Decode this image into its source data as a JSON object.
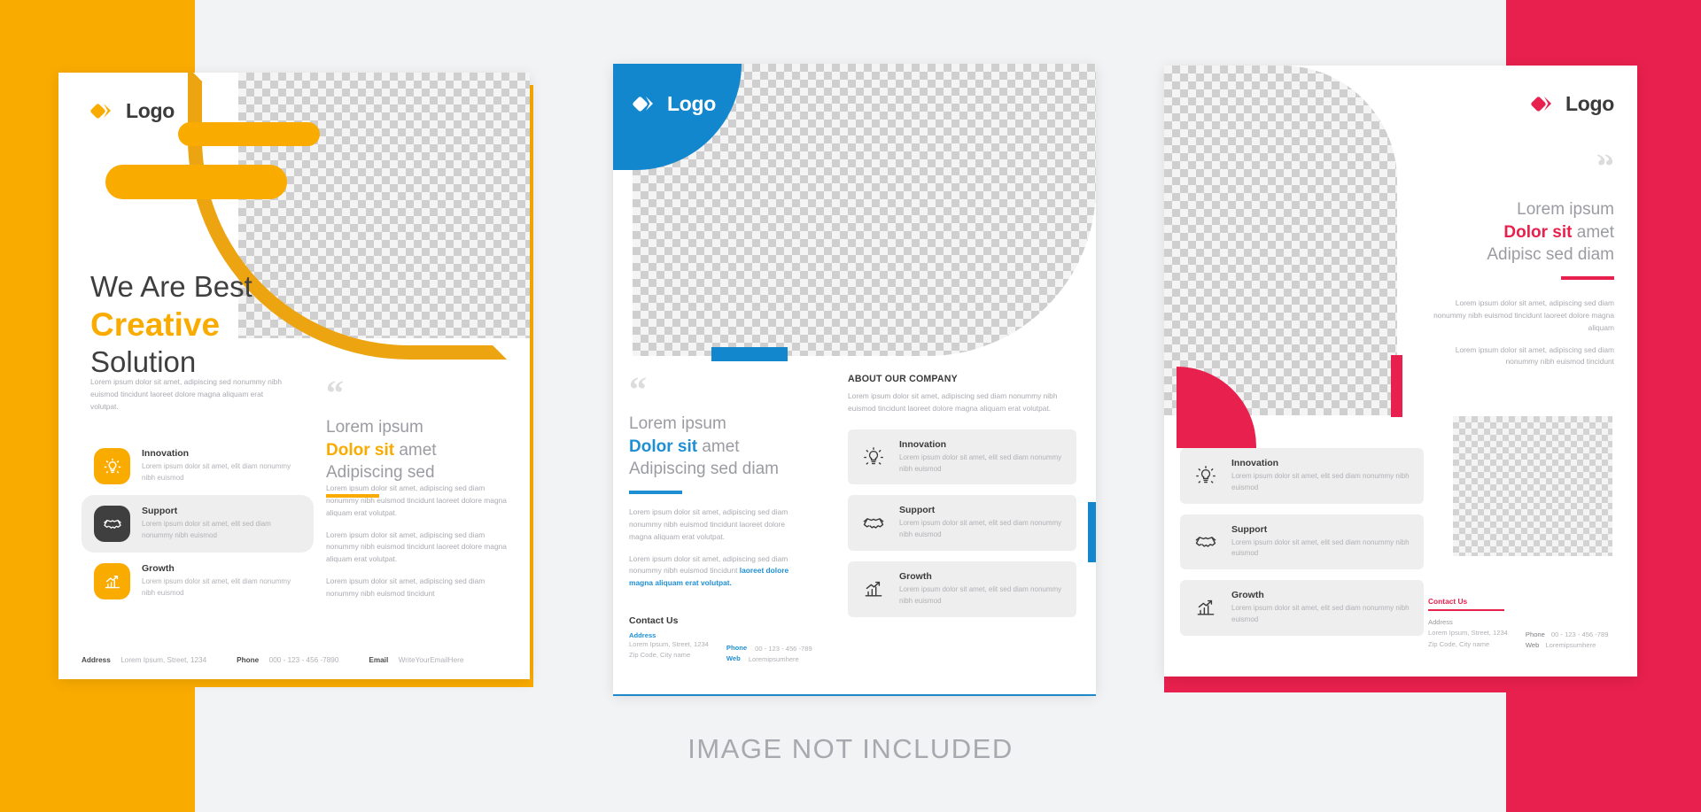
{
  "caption": "IMAGE NOT INCLUDED",
  "colors": {
    "yellow": "#FAAB00",
    "yellow_dark": "#ECA411",
    "blue": "#1287CE",
    "blue_accent": "#1F8FD4",
    "red": "#E8204D",
    "dark": "#3f3f3f",
    "muted": "#b0b1b6",
    "card_bg": "#eeeeee"
  },
  "common": {
    "logo_text": "Logo",
    "quote_glyph": "“",
    "lorem_3line": "Lorem ipsum dolor sit amet, adipiscing sed nonummy nibh euismod tincidunt laoreet dolore magna aliquam erat volutpat.",
    "features": [
      {
        "title": "Innovation",
        "body": "Lorem ipsum dolor sit amet, elit sed diam nonummy nibh euismod",
        "icon": "lightbulb-icon"
      },
      {
        "title": "Support",
        "body": "Lorem ipsum dolor sit amet, elit sed diam nonummy nibh euismod",
        "icon": "handshake-icon"
      },
      {
        "title": "Growth",
        "body": "Lorem ipsum dolor sit amet, elit sed diam nonummy nibh euismod",
        "icon": "bar-chart-growth-icon"
      }
    ]
  },
  "flyer1": {
    "logo_text": "Logo",
    "heading_line1": "We Are Best",
    "heading_line2": "Creative",
    "heading_line3": "Solution",
    "lead": "Lorem ipsum dolor sit amet, adipiscing sed nonummy nibh euismod tincidunt laoreet dolore magna aliquam erat volutpat.",
    "features": [
      {
        "title": "Innovation",
        "body": "Lorem ipsum dolor sit amet, elit diam nonummy nibh euismod",
        "icon": "lightbulb-icon",
        "style": "yellow"
      },
      {
        "title": "Support",
        "body": "Lorem ipsum dolor sit amet, elit sed diam nonummy nibh euismod",
        "icon": "handshake-icon",
        "style": "dark"
      },
      {
        "title": "Growth",
        "body": "Lorem ipsum dolor sit amet, elit diam nonummy nibh euismod",
        "icon": "bar-chart-growth-icon",
        "style": "yellow"
      }
    ],
    "quote": {
      "line1": "Lorem ipsum",
      "line2_bold": "Dolor sit",
      "line2_rest": " amet",
      "line3": "Adipiscing sed"
    },
    "quote_body": [
      "Lorem ipsum dolor sit amet, adipiscing sed diam nonummy nibh euismod tincidunt laoreet dolore magna aliquam erat volutpat.",
      "Lorem ipsum dolor sit amet, adipiscing sed diam nonummy nibh euismod tincidunt laoreet dolore magna aliquam erat volutpat.",
      "Lorem ipsum dolor sit amet, adipiscing sed diam nonummy nibh euismod tincidunt"
    ],
    "footer": {
      "address_label": "Address",
      "address_value": "Lorem Ipsum, Street, 1234",
      "phone_label": "Phone",
      "phone_value": "000 - 123 - 456 -7890",
      "email_label": "Email",
      "email_value": "WriteYourEmailHere"
    }
  },
  "flyer2": {
    "logo_text": "Logo",
    "quote": {
      "line1": "Lorem ipsum",
      "line2_bold": "Dolor sit",
      "line2_rest": " amet",
      "line3": "Adipiscing sed diam"
    },
    "body_p1": "Lorem ipsum dolor sit amet, adipiscing sed diam nonummy nibh euismod tincidunt laoreet dolore magna aliquam erat volutpat.",
    "body_p2_plain": "Lorem ipsum dolor sit amet, adipiscing sed diam nonummy nibh euismod tincidunt ",
    "body_p2_accent": "laoreet dolore magna aliquam erat volutpat.",
    "about_title": "ABOUT OUR COMPANY",
    "about_body": "Lorem ipsum dolor sit amet, adipiscing sed diam nonummy nibh euismod tincidunt laoreet dolore magna aliquam erat volutpat.",
    "features": [
      {
        "title": "Innovation",
        "body": "Lorem ipsum dolor sit amet, elit sed diam nonummy nibh euismod",
        "icon": "lightbulb-icon"
      },
      {
        "title": "Support",
        "body": "Lorem ipsum dolor sit amet, elit sed diam nonummy nibh euismod",
        "icon": "handshake-icon"
      },
      {
        "title": "Growth",
        "body": "Lorem ipsum dolor sit amet, elit sed diam nonummy nibh euismod",
        "icon": "bar-chart-growth-icon"
      }
    ],
    "contact": {
      "title": "Contact Us",
      "address_label": "Address",
      "address_line1": "Lorem Ipsum, Street, 1234",
      "address_line2": "Zip Code, City name",
      "phone_label": "Phone",
      "phone_value": "00 - 123 - 456 -789",
      "web_label": "Web",
      "web_value": "Loremipsumhere"
    }
  },
  "flyer3": {
    "logo_text": "Logo",
    "quote": {
      "line1": "Lorem ipsum",
      "line2_bold": "Dolor sit",
      "line2_rest": " amet",
      "line3": "Adipisc sed diam"
    },
    "body_p1": "Lorem ipsum dolor sit amet, adipiscing sed diam nonummy nibh euismod tincidunt laoreet dolore magna aliquam",
    "body_p2": "Lorem ipsum dolor sit amet, adipiscing sed diam nonummy nibh euismod tincidunt",
    "features": [
      {
        "title": "Innovation",
        "body": "Lorem ipsum dolor sit amet, elit sed diam nonummy nibh euismod",
        "icon": "lightbulb-icon"
      },
      {
        "title": "Support",
        "body": "Lorem ipsum dolor sit amet, elit sed diam nonummy nibh euismod",
        "icon": "handshake-icon"
      },
      {
        "title": "Growth",
        "body": "Lorem ipsum dolor sit amet, elit sed diam nonummy nibh euismod",
        "icon": "bar-chart-growth-icon"
      }
    ],
    "contact": {
      "title": "Contact Us",
      "address_label": "Address",
      "address_line1": "Lorem Ipsum, Street, 1234",
      "address_line2": "Zip Code, City name",
      "phone_label": "Phone",
      "phone_value": "00 - 123 - 456 -789",
      "web_label": "Web",
      "web_value": "Loremipsumhere"
    }
  }
}
